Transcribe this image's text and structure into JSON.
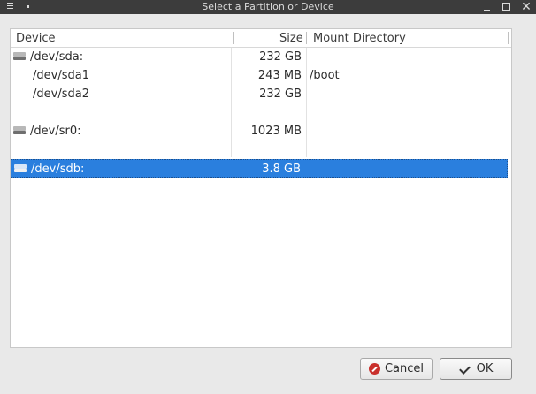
{
  "window": {
    "title": "Select a Partition or Device"
  },
  "table": {
    "columns": {
      "device": "Device",
      "size": "Size",
      "mount": "Mount Directory"
    },
    "rows": [
      {
        "device": "/dev/sda:",
        "size": "232 GB",
        "mount": "",
        "type": "disk",
        "selected": false
      },
      {
        "device": "/dev/sda1",
        "size": "243 MB",
        "mount": "/boot",
        "type": "partition",
        "selected": false
      },
      {
        "device": "/dev/sda2",
        "size": "232 GB",
        "mount": "",
        "type": "partition",
        "selected": false
      },
      {
        "device": "/dev/sr0:",
        "size": "1023 MB",
        "mount": "",
        "type": "disk",
        "selected": false
      },
      {
        "device": "/dev/sdb:",
        "size": "3.8 GB",
        "mount": "",
        "type": "disk",
        "selected": true
      }
    ]
  },
  "buttons": {
    "cancel": "Cancel",
    "ok": "OK"
  },
  "colors": {
    "selection": "#2a7fde",
    "titlebar": "#3c3c3c",
    "cancel_icon": "#c9302c"
  }
}
